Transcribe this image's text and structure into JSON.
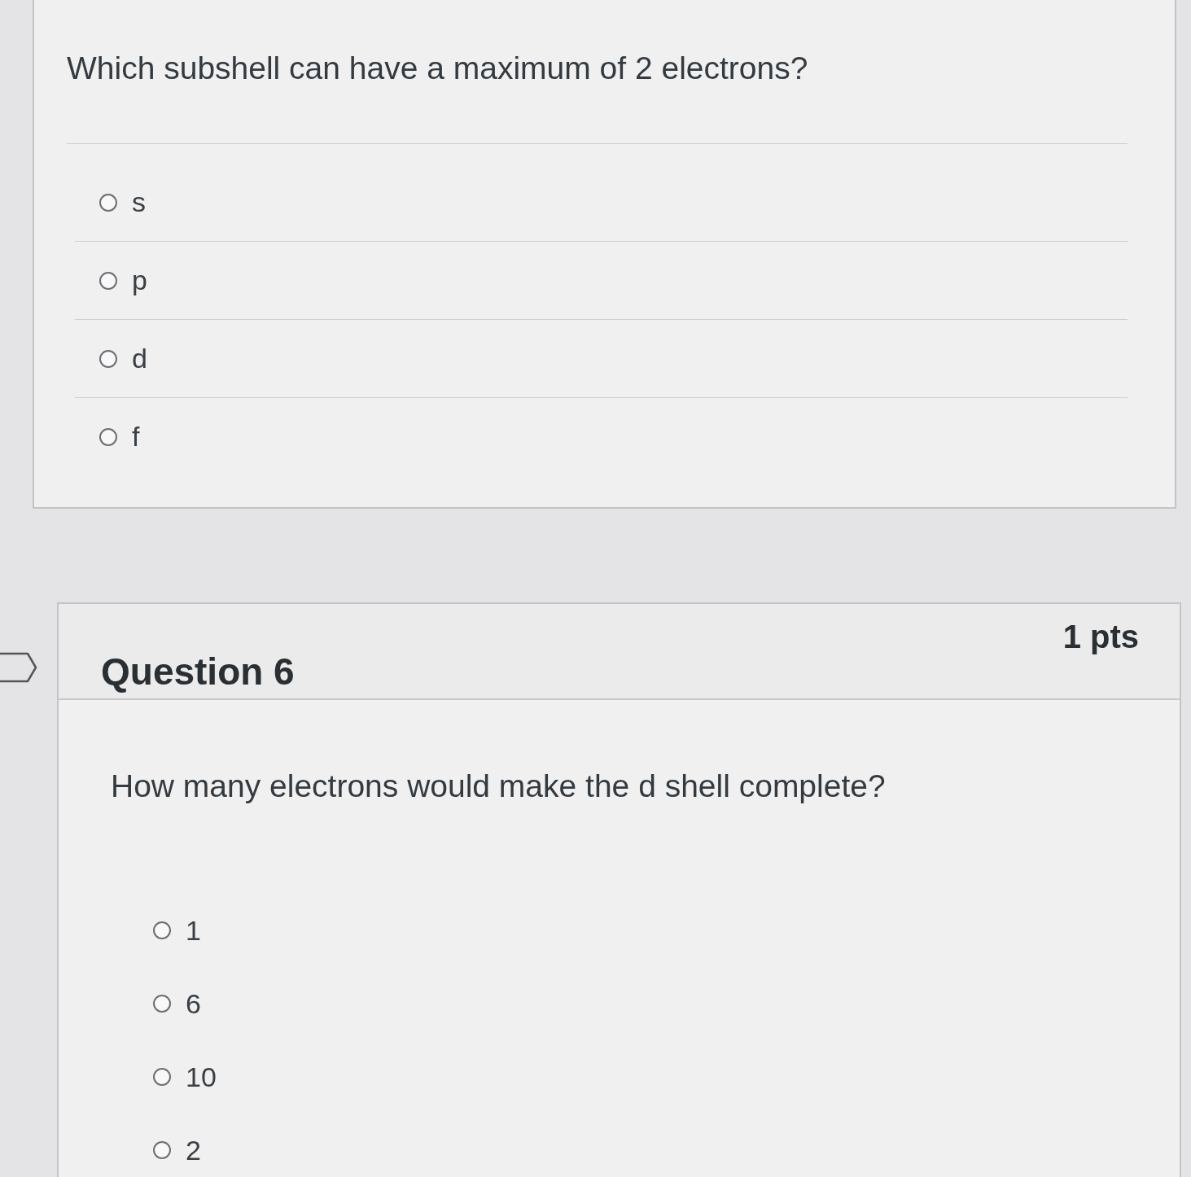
{
  "questions": [
    {
      "prompt": "Which subshell can have a maximum of 2 electrons?",
      "answers": [
        {
          "label": "s",
          "selected": false
        },
        {
          "label": "p",
          "selected": false
        },
        {
          "label": "d",
          "selected": false
        },
        {
          "label": "f",
          "selected": false
        }
      ]
    },
    {
      "title": "Question 6",
      "points": "1 pts",
      "flagged": false,
      "prompt": "How many electrons would make the d shell complete?",
      "answers": [
        {
          "label": "1",
          "selected": false
        },
        {
          "label": "6",
          "selected": false
        },
        {
          "label": "10",
          "selected": false
        },
        {
          "label": "2",
          "selected": false
        }
      ]
    }
  ]
}
